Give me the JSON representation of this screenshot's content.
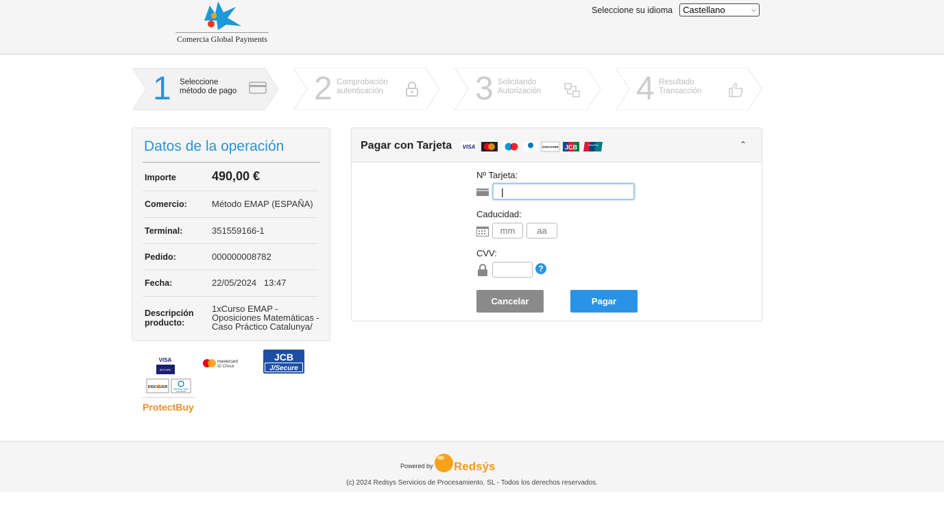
{
  "header": {
    "logo_text": "Comercia Global Payments",
    "language_label": "Seleccione su idioma",
    "language_selected": "Castellano"
  },
  "steps": [
    {
      "number": "1",
      "line1": "Seleccione",
      "line2": "método de pago",
      "icon": "card-icon",
      "active": true
    },
    {
      "number": "2",
      "line1": "Comprobación",
      "line2": "autenticación",
      "icon": "lock-icon",
      "active": false
    },
    {
      "number": "3",
      "line1": "Solicitando",
      "line2": "Autorización",
      "icon": "transfer-icon",
      "active": false
    },
    {
      "number": "4",
      "line1": "Resultado",
      "line2": "Transacción",
      "icon": "thumbs-up-icon",
      "active": false
    }
  ],
  "operation": {
    "title": "Datos de la operación",
    "rows": [
      {
        "label": "Importe",
        "value": "490,00 €"
      },
      {
        "label": "Comercio:",
        "value": "Método EMAP (ESPAÑA)"
      },
      {
        "label": "Terminal:",
        "value": "351559166-1"
      },
      {
        "label": "Pedido:",
        "value": "000000008782"
      },
      {
        "label": "Fecha:",
        "value": "22/05/2024   13:47"
      },
      {
        "label": "Descripción producto:",
        "value": "1xCurso EMAP - Oposiciones Matemáticas - Caso Práctico Catalunya/"
      }
    ]
  },
  "brands": {
    "visa_secure": [
      "VISA",
      "SECURE"
    ],
    "mastercard_idcheck": [
      "mastercard",
      "ID Check"
    ],
    "jcb_secure": [
      "JCB",
      "J/Secure"
    ],
    "discover": "DISCOVER",
    "diners": [
      "Diners Club",
      "International"
    ],
    "protectbuy": "ProtectBuy"
  },
  "card_form": {
    "title": "Pagar con Tarjeta",
    "card_logos": [
      "VISA",
      "mastercard",
      "maestro",
      "diners",
      "DISCOVER",
      "JCB",
      "UnionPay"
    ],
    "card_number_label": "Nº Tarjeta:",
    "card_number_value": "|",
    "expiry_label": "Caducidad:",
    "month_placeholder": "mm",
    "year_placeholder": "aa",
    "cvv_label": "CVV:",
    "cvv_help": "?",
    "cancel_label": "Cancelar",
    "pay_label": "Pagar"
  },
  "footer": {
    "powered_by": "Powered by",
    "brand": "Redsýs",
    "copyright": "(c) 2024 Redsys Servicios de Procesamiento. SL - Todos los derechos reservados."
  },
  "colors": {
    "accent_blue": "#2a93d5",
    "pay_button": "#2a93e6",
    "cancel_button": "#8a8a8a",
    "redsys_orange": "#f39a1e",
    "caixa_blue": "#1c9ad6"
  }
}
